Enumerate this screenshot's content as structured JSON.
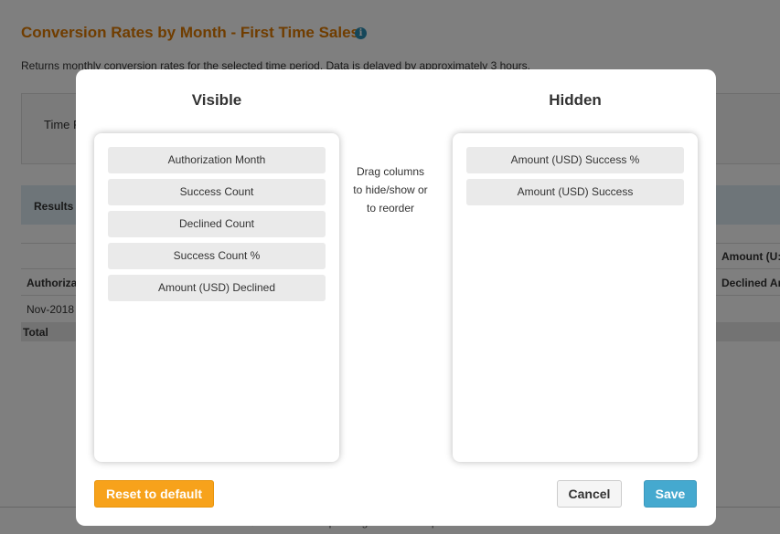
{
  "page": {
    "title": "Conversion Rates by Month - First Time Sales",
    "info_icon": "i",
    "description": "Returns monthly conversion rates for the selected time period. Data is delayed by approximately 3 hours.",
    "filter_label": "Time F",
    "results_label": "Results",
    "table": {
      "top_header_right": "Amount (U:",
      "header_left": "Authoriza",
      "header_right": "Declined Ar",
      "row_first_cell": "Nov-2018",
      "total_label": "Total"
    },
    "footer": "© 2018 BlueSnap. All rights reserved | Terms & Conditions"
  },
  "modal": {
    "visible_title": "Visible",
    "hidden_title": "Hidden",
    "hint": "Drag columns to hide/show or to reorder",
    "visible_columns": [
      "Authorization Month",
      "Success Count",
      "Declined Count",
      "Success Count %",
      "Amount (USD) Declined"
    ],
    "hidden_columns": [
      "Amount (USD) Success %",
      "Amount (USD) Success"
    ],
    "buttons": {
      "reset": "Reset to default",
      "cancel": "Cancel",
      "save": "Save"
    }
  },
  "colors": {
    "title_orange": "#e07b00",
    "reset_orange": "#f7a21b",
    "save_blue": "#45a9cf"
  }
}
